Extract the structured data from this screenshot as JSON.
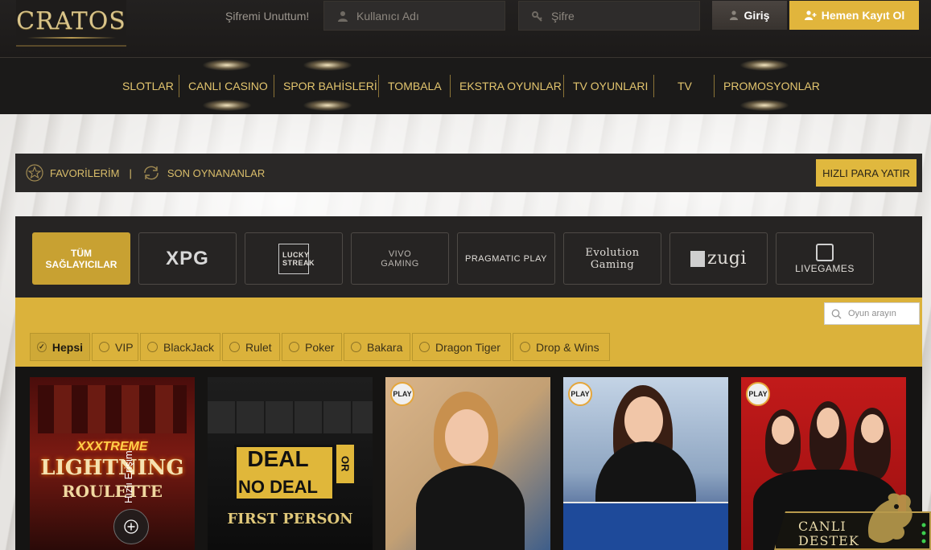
{
  "header": {
    "logo_text": "CRATOS",
    "forgot_password": "Şifremi Unuttum!",
    "username_placeholder": "Kullanıcı Adı",
    "password_placeholder": "Şifre",
    "login_label": "Giriş",
    "register_label": "Hemen Kayıt Ol"
  },
  "nav": {
    "items": [
      "SLOTLAR",
      "CANLI CASINO",
      "SPOR BAHİSLERİ",
      "TOMBALA",
      "EKSTRA OYUNLAR",
      "TV OYUNLARI",
      "TV",
      "PROMOSYONLAR"
    ]
  },
  "favbar": {
    "favorites": "FAVORİLERİM",
    "divider": "|",
    "recent": "SON OYNANANLAR",
    "deposit": "HIZLI PARA YATIR"
  },
  "providers": {
    "all_line1": "TÜM",
    "all_line2": "SAĞLAYICILAR",
    "items": [
      "XPG",
      "LUCKY STREAK",
      "VIVO GAMING",
      "PRAGMATIC PLAY",
      "Evolution Gaming",
      "zugi",
      "LIVEGAMES"
    ]
  },
  "categories": {
    "search_placeholder": "Oyun arayın",
    "items": [
      "Hepsi",
      "VIP",
      "BlackJack",
      "Rulet",
      "Poker",
      "Bakara",
      "Dragon Tiger",
      "Drop & Wins"
    ]
  },
  "games": {
    "lightning_top": "XXXTREME",
    "lightning_mid": "LIGHTNING",
    "lightning_bot": "ROULETTE",
    "deal_line1": "DEAL",
    "deal_or": "OR",
    "deal_line2": "NO DEAL",
    "deal_sub": "FIRST PERSON",
    "play_badge": "PLAY"
  },
  "widgets": {
    "quick_access": "Hızlı Erişim",
    "support_line1": "CANLI",
    "support_line2": "DESTEK"
  },
  "colors": {
    "gold": "#e1b53c",
    "dark": "#1b1a19",
    "nav_text": "#e3c56e"
  }
}
